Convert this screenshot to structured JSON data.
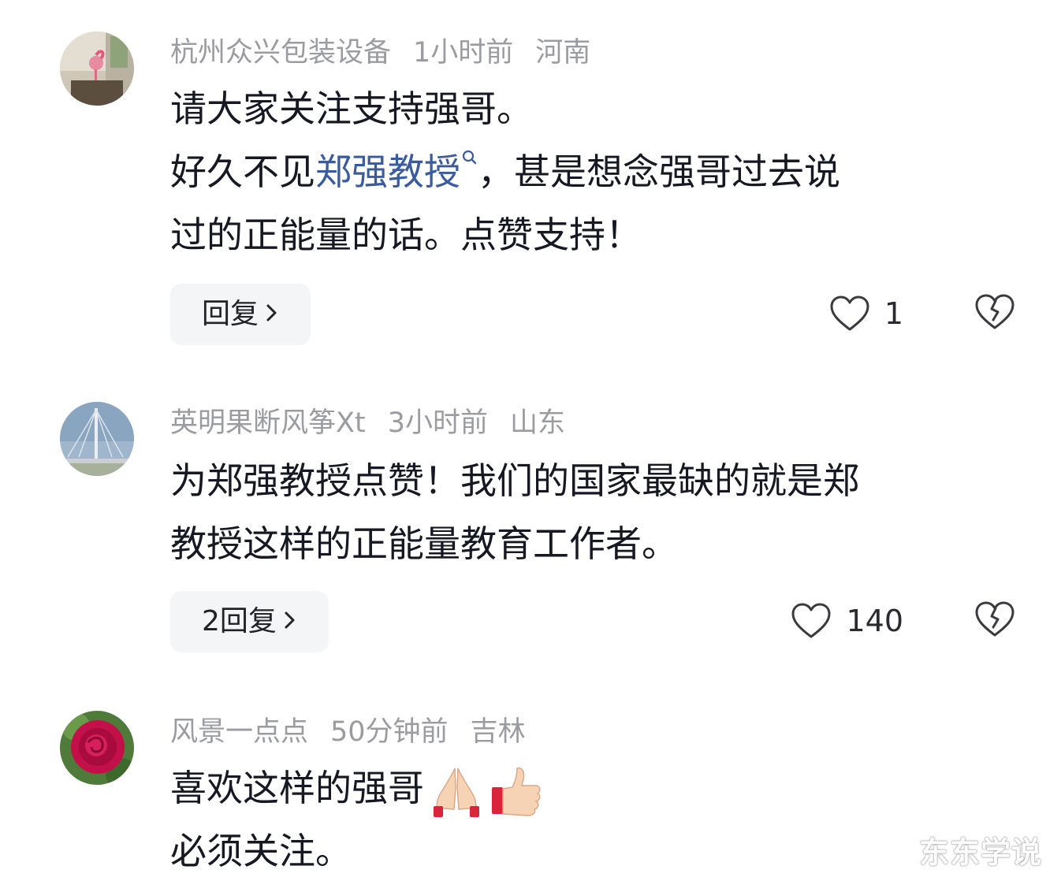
{
  "comments": [
    {
      "username": "杭州众兴包装设备",
      "time": "1小时前",
      "location": "河南",
      "lines": [
        "请大家关注支持强哥。"
      ],
      "line2_pre": "好久不见",
      "line2_link": "郑强教授",
      "line2_post": "，甚是想念强哥过去说",
      "line3": "过的正能量的话。点赞支持！",
      "reply_label": "回复",
      "like_count": "1",
      "avatar": "avatar-flamingo"
    },
    {
      "username": "英明果断风筝Xt",
      "time": "3小时前",
      "location": "山东",
      "lines": [
        "为郑强教授点赞！我们的国家最缺的就是郑",
        "教授这样的正能量教育工作者。"
      ],
      "reply_label": "2回复",
      "like_count": "140",
      "avatar": "avatar-bridge"
    },
    {
      "username": "风景一点点",
      "time": "50分钟前",
      "location": "吉林",
      "lines": [
        "喜欢这样的强哥",
        "必须关注。"
      ],
      "emojis": [
        "folded-hands-emoji",
        "thumbs-up-emoji"
      ],
      "avatar": "avatar-rose"
    }
  ],
  "watermark": "东东学说",
  "colors": {
    "meta_text": "#9a9ca1",
    "body_text": "#161823",
    "link": "#3a5b9e",
    "reply_bg": "#f4f5f7"
  }
}
